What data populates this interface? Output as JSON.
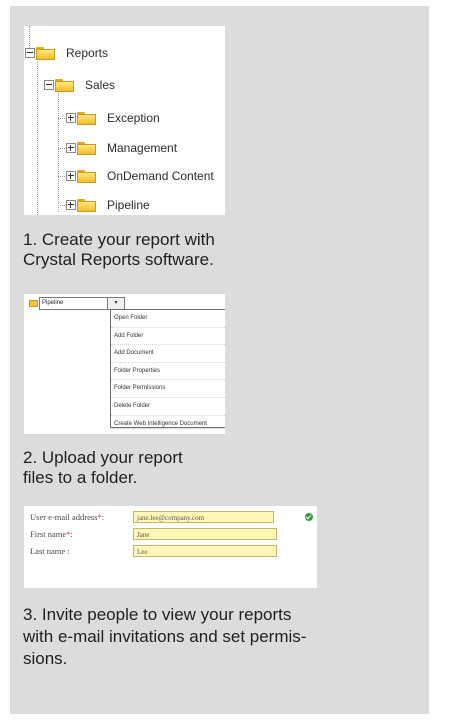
{
  "tree": {
    "items": [
      {
        "label": "Reports",
        "expanded": true
      },
      {
        "label": "Sales",
        "expanded": true
      },
      {
        "label": "Exception",
        "expanded": false
      },
      {
        "label": "Management",
        "expanded": false
      },
      {
        "label": "OnDemand Content",
        "expanded": false
      },
      {
        "label": "Pipeline",
        "expanded": false
      }
    ]
  },
  "steps": [
    {
      "lines": [
        "1. Create your report with",
        "Crystal Reports software."
      ]
    },
    {
      "lines": [
        "2. Upload your report",
        "files to a folder."
      ]
    },
    {
      "lines": [
        "3. Invite people to view your reports",
        "with e-mail invitations and set permis-",
        "sions."
      ]
    }
  ],
  "context_menu": {
    "folder_name": "Pipeline",
    "dropdown_glyph": "▾",
    "items": [
      "Open Folder",
      "Add Folder",
      "Add Document",
      "Folder Properties",
      "Folder Permissions",
      "Delete Folder",
      "Create Web Intelligence Document"
    ]
  },
  "invite_form": {
    "fields": [
      {
        "label": "User e-mail address",
        "required": true,
        "value": "jane.lee@company.com",
        "valid": true
      },
      {
        "label": "First name",
        "required": true,
        "value": "Jane"
      },
      {
        "label": "Last name",
        "required": false,
        "value": "Lee"
      }
    ],
    "required_marker": "*",
    "separator": ":"
  },
  "colors": {
    "panel_background": "#dcdcda",
    "field_highlight": "#fff7b5",
    "folder_yellow": "#f2bd2c",
    "valid_green": "#2f9e3c",
    "required_red": "#c83a3a"
  },
  "icons": [
    "folder-icon",
    "expand-plus-icon",
    "collapse-minus-icon",
    "checkmark-icon"
  ]
}
